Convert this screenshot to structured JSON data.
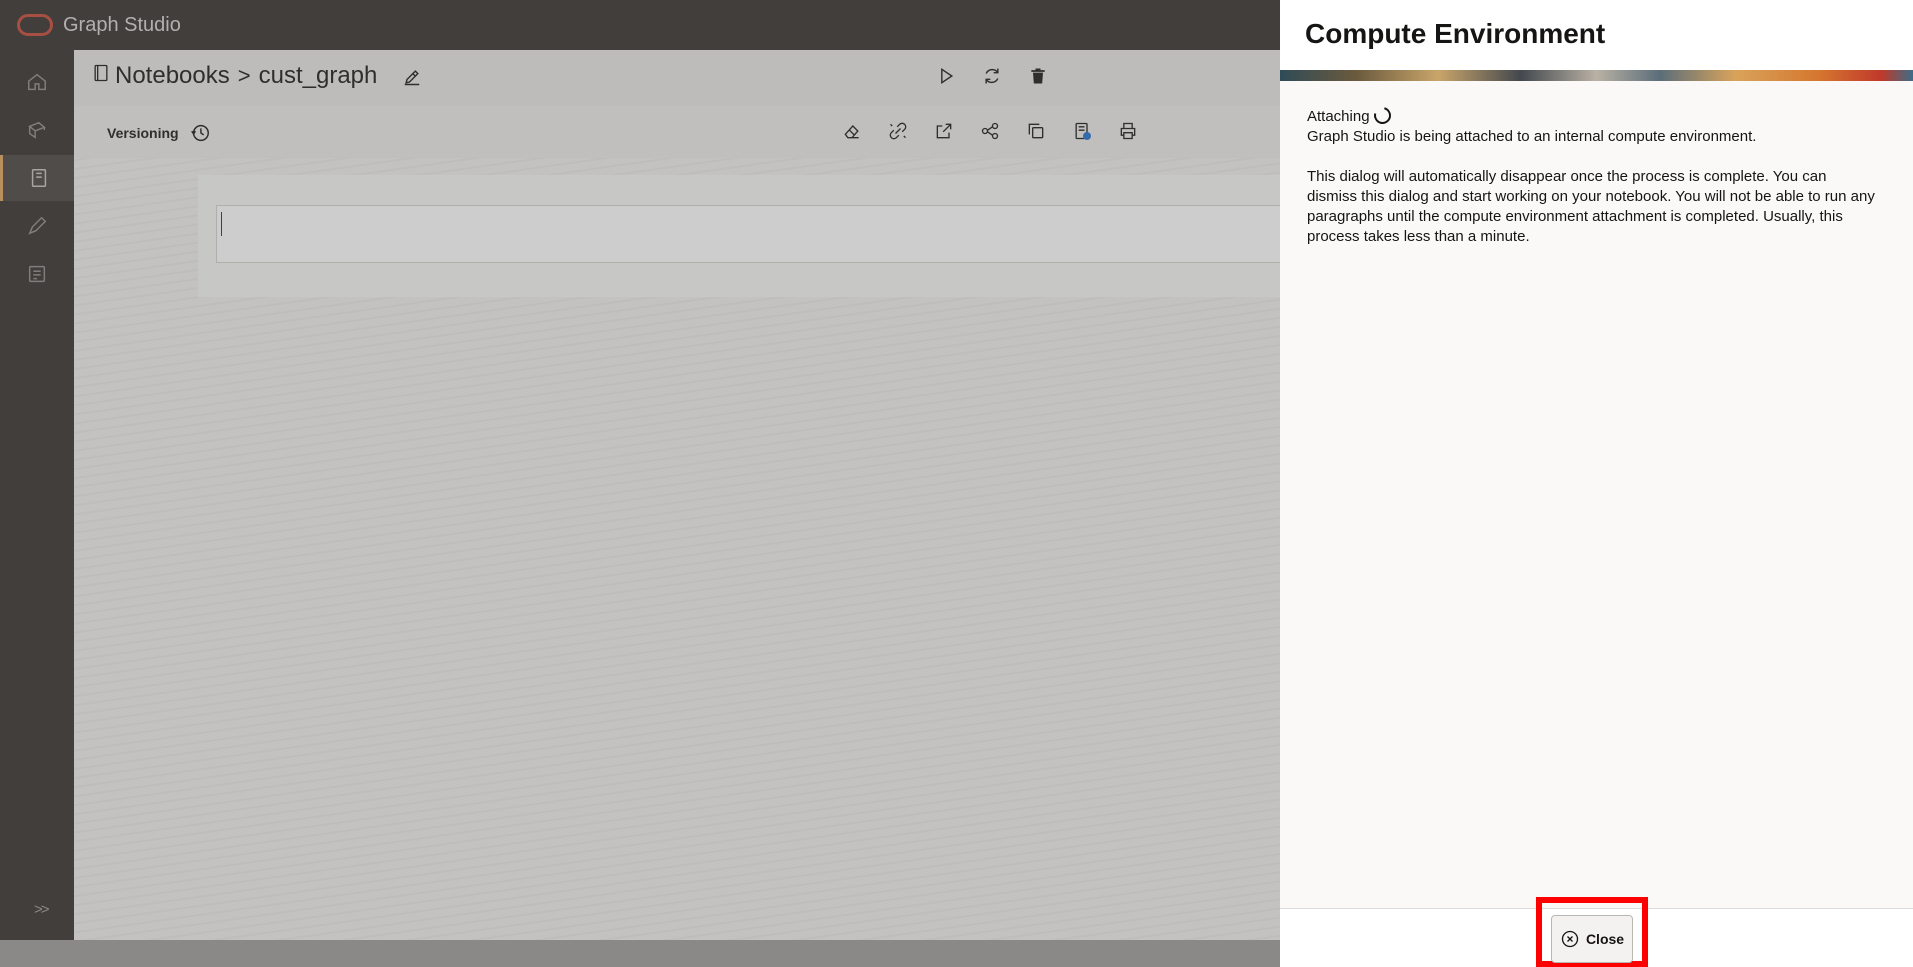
{
  "app": {
    "title": "Graph Studio",
    "brand_color": "#c74634"
  },
  "rail": {
    "items": [
      {
        "icon": "home-icon"
      },
      {
        "icon": "models-icon"
      },
      {
        "icon": "notebooks-icon",
        "active": true
      },
      {
        "icon": "pen-icon"
      },
      {
        "icon": "jobs-icon"
      }
    ],
    "expand_label": ">>"
  },
  "notebook": {
    "breadcrumb_root": "Notebooks",
    "breadcrumb_separator": ">",
    "name": "cust_graph",
    "versioning_label": "Versioning"
  },
  "header_actions": [
    "play-icon",
    "refresh-icon",
    "trash-icon"
  ],
  "toolbar_icons": [
    "eraser-icon",
    "break-link-icon",
    "export-icon",
    "share-icon",
    "copy-icon",
    "notebook-settings-icon",
    "print-icon"
  ],
  "drawer": {
    "title": "Compute Environment",
    "status": "Attaching",
    "message1": "Graph Studio is being attached to an internal compute environment.",
    "message2": "This dialog will automatically disappear once the process is complete. You can dismiss this dialog and start working on your notebook. You will not be able to run any paragraphs until the compute environment attachment is completed. Usually, this process takes less than a minute.",
    "close_label": "Close",
    "highlight_color": "#ff0000"
  }
}
